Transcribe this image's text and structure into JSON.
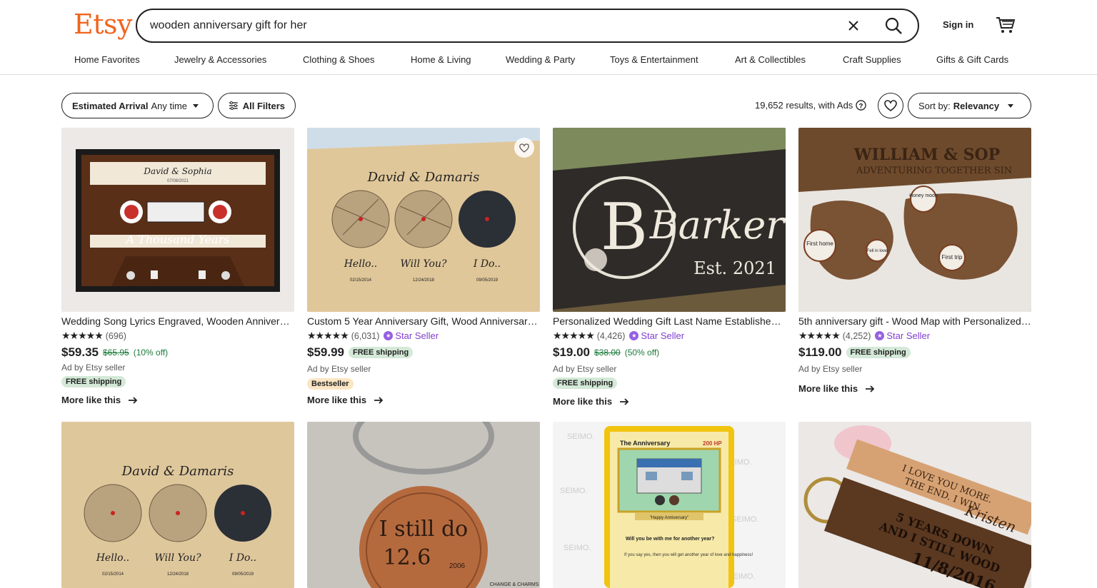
{
  "header": {
    "logo": "Etsy",
    "search_value": "wooden anniversary gift for her",
    "signin": "Sign in"
  },
  "nav": [
    "Home Favorites",
    "Jewelry & Accessories",
    "Clothing & Shoes",
    "Home & Living",
    "Wedding & Party",
    "Toys & Entertainment",
    "Art & Collectibles",
    "Craft Supplies",
    "Gifts & Gift Cards"
  ],
  "filters": {
    "arrival_label": "Estimated Arrival",
    "arrival_value": "Any time",
    "all_filters": "All Filters",
    "results": "19,652 results, with Ads",
    "sort_label": "Sort by:",
    "sort_value": "Relevancy"
  },
  "listings": [
    {
      "title": "Wedding Song Lyrics Engraved, Wooden Anniversary Gift",
      "stars": "★★★★★",
      "reviews": "(696)",
      "star_seller": "",
      "price": "$59.35",
      "original_price": "$65.95",
      "discount": "(10% off)",
      "shipping_inline": "",
      "ad": "Ad by Etsy seller",
      "badge": "FREE shipping",
      "more": "More like this",
      "img_text": [
        "David & Sophia",
        "07/08/2021",
        "A Thousand Years"
      ]
    },
    {
      "title": "Custom 5 Year Anniversary Gift, Wood Anniversary Map",
      "stars": "★★★★★",
      "reviews": "(6,031)",
      "star_seller": "Star Seller",
      "price": "$59.99",
      "original_price": "",
      "discount": "",
      "shipping_inline": "FREE shipping",
      "ad": "Ad by Etsy seller",
      "badge": "Bestseller",
      "more": "More like this",
      "img_text": [
        "David & Damaris",
        "Hello..",
        "Will You?",
        "I Do..",
        "02/15/2014",
        "12/24/2018",
        "09/05/2019"
      ]
    },
    {
      "title": "Personalized Wedding Gift Last Name Established Sign",
      "stars": "★★★★★",
      "reviews": "(4,426)",
      "star_seller": "Star Seller",
      "price": "$19.00",
      "original_price": "$38.00",
      "discount": "(50% off)",
      "shipping_inline": "",
      "ad": "Ad by Etsy seller",
      "badge": "FREE shipping",
      "more": "More like this",
      "img_text": [
        "B",
        "Barker",
        "Est. 2021"
      ]
    },
    {
      "title": "5th anniversary gift - Wood Map with Personalized Pins",
      "stars": "★★★★★",
      "reviews": "(4,252)",
      "star_seller": "Star Seller",
      "price": "$119.00",
      "original_price": "",
      "discount": "",
      "shipping_inline": "FREE shipping",
      "ad": "Ad by Etsy seller",
      "badge": "",
      "more": "More like this",
      "img_text": [
        "WILLIAM & SOP",
        "ADVENTURING TOGETHER SIN",
        "Honey moon",
        "First home",
        "Fell in love",
        "First trip"
      ]
    }
  ],
  "row2_img_text": {
    "map": [
      "David & Damaris",
      "Hello..",
      "Will You?",
      "I Do..",
      "02/15/2014",
      "12/24/2018",
      "09/05/2019"
    ],
    "penny": [
      "I still do",
      "12.6",
      "2006",
      "CHANGE & CHARMS"
    ],
    "card": [
      "The Anniversary",
      "200 HP",
      "\"Happy Anniversary\"",
      "Will you be with me for another year?",
      "If you say yes, then you will get another year of love and happiness!",
      "SEIMO."
    ],
    "keychain": [
      "I LOVE YOU MORE.",
      "THE END. I WIN.",
      "Kristen",
      "5 YEARS DOWN",
      "AND I STILL WOOD",
      "11/8/2016"
    ]
  },
  "colors": {
    "brand": "#f1641e",
    "star_seller": "#7f3fcf",
    "sale": "#1c7a3a"
  }
}
